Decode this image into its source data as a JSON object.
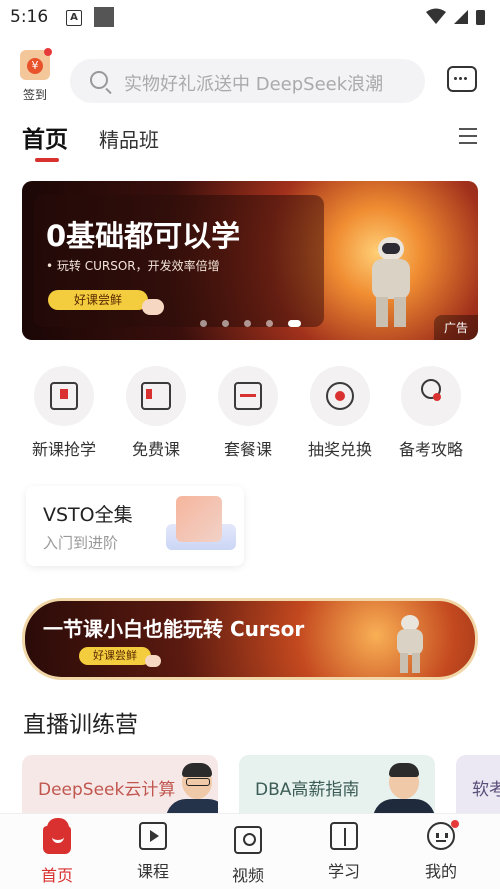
{
  "status_bar": {
    "time": "5:16",
    "a_icon": "A"
  },
  "header": {
    "checkin_label": "签到",
    "checkin_coin": "¥",
    "search_placeholder": "实物好礼派送中 DeepSeek浪潮",
    "message_icon": "message-icon"
  },
  "tabs": [
    {
      "label": "首页",
      "active": true
    },
    {
      "label": "精品班",
      "active": false
    }
  ],
  "banner": {
    "title": "0基础都可以学",
    "subtitle": "• 玩转 CURSOR，开发效率倍增",
    "button": "好课尝鲜",
    "ad_label": "广告",
    "slide_index": 5,
    "slide_count": 5
  },
  "quick_actions": [
    {
      "label": "新课抢学",
      "icon": "bookmark-book-icon"
    },
    {
      "label": "免费课",
      "icon": "open-book-icon"
    },
    {
      "label": "套餐课",
      "icon": "folder-package-icon"
    },
    {
      "label": "抽奖兑换",
      "icon": "lottery-icon"
    },
    {
      "label": "备考攻略",
      "icon": "user-guide-icon"
    }
  ],
  "vsto_card": {
    "title": "VSTO全集",
    "subtitle": "入门到进阶"
  },
  "promo_strip": {
    "title": "一节课小白也能玩转 Cursor",
    "button": "好课尝鲜"
  },
  "live_section": {
    "title": "直播训练营",
    "cards": [
      {
        "title": "DeepSeek云计算",
        "bg": "#f7e8e8",
        "color": "#c0574f"
      },
      {
        "title": "DBA高薪指南",
        "bg": "#e7f1ee",
        "color": "#3c5d55"
      },
      {
        "title": "软考",
        "bg": "#ece8f3",
        "color": "#5a4e7a"
      }
    ]
  },
  "bottom_nav": [
    {
      "label": "首页",
      "active": true
    },
    {
      "label": "课程",
      "active": false
    },
    {
      "label": "视频",
      "active": false
    },
    {
      "label": "学习",
      "active": false
    },
    {
      "label": "我的",
      "active": false
    }
  ],
  "colors": {
    "accent": "#d9312f",
    "badge": "#e63a3a"
  }
}
